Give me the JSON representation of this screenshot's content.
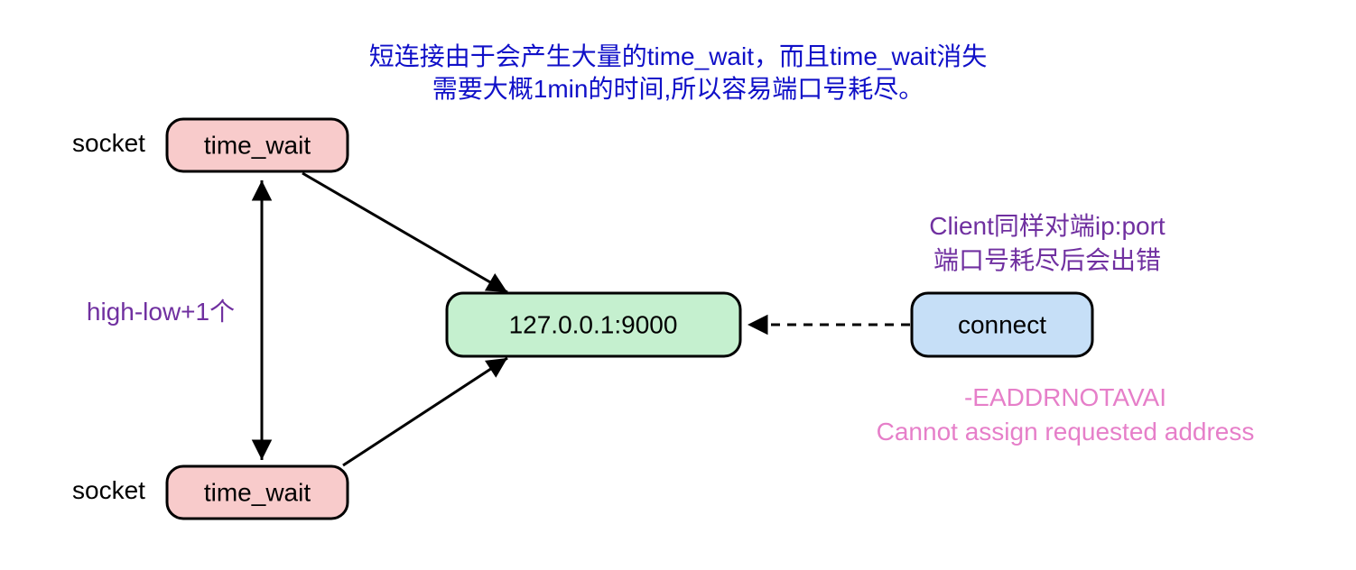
{
  "title": {
    "line1": "短连接由于会产生大量的time_wait，而且time_wait消失",
    "line2": "需要大概1min的时间,所以容易端口号耗尽。"
  },
  "nodes": {
    "socket_top": "socket",
    "socket_bottom": "socket",
    "time_wait_top": "time_wait",
    "time_wait_bottom": "time_wait",
    "server": "127.0.0.1:9000",
    "connect": "connect"
  },
  "labels": {
    "range": "high-low+1个"
  },
  "client_note": {
    "line1": "Client同样对端ip:port",
    "line2": "端口号耗尽后会出错"
  },
  "error": {
    "line1": "-EADDRNOTAVAI",
    "line2": "Cannot assign requested address"
  },
  "colors": {
    "title": "#1010c8",
    "purple": "#7030a0",
    "pink": "#e67fc9",
    "pink_fill": "#f8cbcb",
    "green_fill": "#c5f0cf",
    "blue_fill": "#c6dff7",
    "stroke": "#000"
  }
}
